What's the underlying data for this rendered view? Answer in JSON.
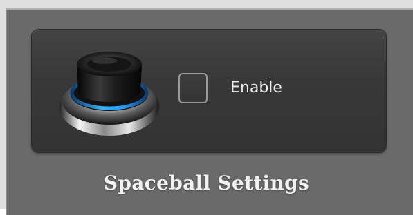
{
  "window": {
    "title": "Spaceball Settings"
  },
  "device": {
    "icon": "spacemouse-controller-icon",
    "accent_color": "#1e9bff"
  },
  "enable_option": {
    "label": "Enable",
    "checked": false
  },
  "colors": {
    "panel_background": "#6a6a6a",
    "card_background": "#3a3a3a",
    "text": "#f0f0f0"
  }
}
